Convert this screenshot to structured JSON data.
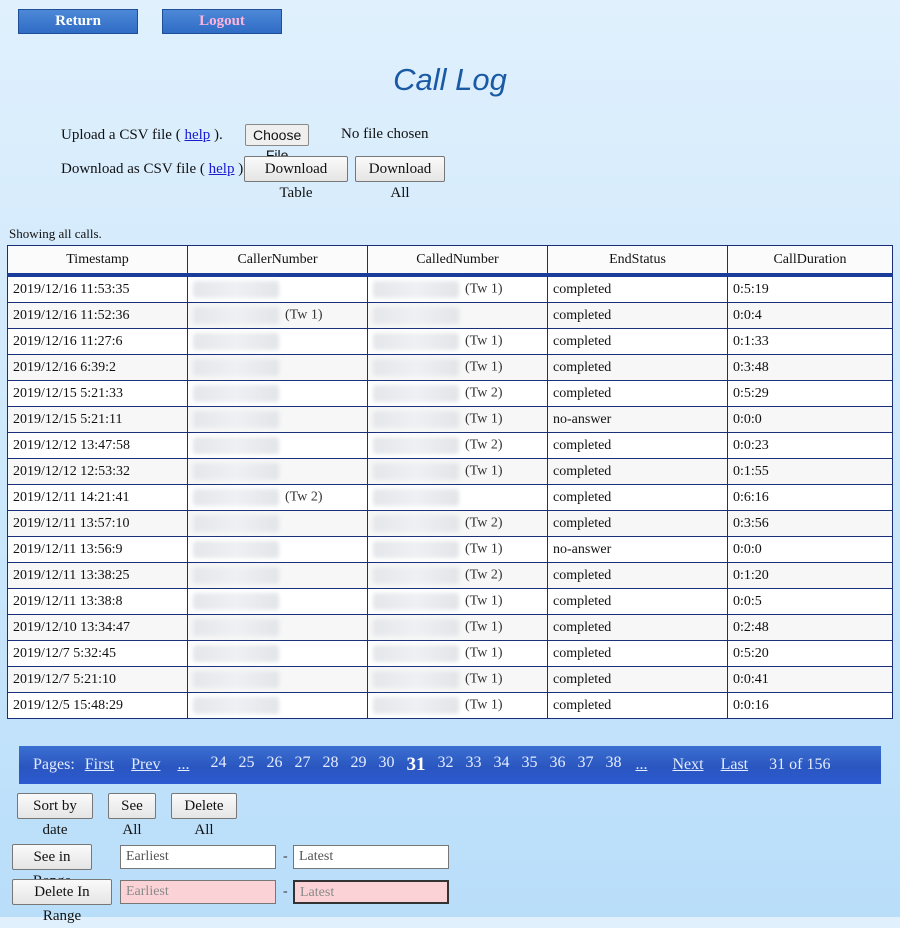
{
  "nav": {
    "return_label": "Return",
    "logout_label": "Logout"
  },
  "title": "Call Log",
  "upload": {
    "text": "Upload a CSV file (",
    "help": "help",
    "close": ").",
    "button": "Choose File",
    "status": "No file chosen"
  },
  "download": {
    "text": "Download as CSV file (",
    "help": "help",
    "close": ").",
    "table_button": "Download Table",
    "all_button": "Download All"
  },
  "showing": "Showing all calls.",
  "table": {
    "headers": [
      "Timestamp",
      "CallerNumber",
      "CalledNumber",
      "EndStatus",
      "CallDuration"
    ],
    "rows": [
      {
        "ts": "2019/12/16 11:53:35",
        "caller_tw": "",
        "called_tw": "(Tw 1)",
        "status": "completed",
        "dur": "0:5:19"
      },
      {
        "ts": "2019/12/16 11:52:36",
        "caller_tw": "(Tw 1)",
        "called_tw": "",
        "status": "completed",
        "dur": "0:0:4"
      },
      {
        "ts": "2019/12/16 11:27:6",
        "caller_tw": "",
        "called_tw": "(Tw 1)",
        "status": "completed",
        "dur": "0:1:33"
      },
      {
        "ts": "2019/12/16 6:39:2",
        "caller_tw": "",
        "called_tw": "(Tw 1)",
        "status": "completed",
        "dur": "0:3:48"
      },
      {
        "ts": "2019/12/15 5:21:33",
        "caller_tw": "",
        "called_tw": "(Tw 2)",
        "status": "completed",
        "dur": "0:5:29"
      },
      {
        "ts": "2019/12/15 5:21:11",
        "caller_tw": "",
        "called_tw": "(Tw 1)",
        "status": "no-answer",
        "dur": "0:0:0"
      },
      {
        "ts": "2019/12/12 13:47:58",
        "caller_tw": "",
        "called_tw": "(Tw 2)",
        "status": "completed",
        "dur": "0:0:23"
      },
      {
        "ts": "2019/12/12 12:53:32",
        "caller_tw": "",
        "called_tw": "(Tw 1)",
        "status": "completed",
        "dur": "0:1:55"
      },
      {
        "ts": "2019/12/11 14:21:41",
        "caller_tw": "(Tw 2)",
        "called_tw": "",
        "status": "completed",
        "dur": "0:6:16"
      },
      {
        "ts": "2019/12/11 13:57:10",
        "caller_tw": "",
        "called_tw": "(Tw 2)",
        "status": "completed",
        "dur": "0:3:56"
      },
      {
        "ts": "2019/12/11 13:56:9",
        "caller_tw": "",
        "called_tw": "(Tw 1)",
        "status": "no-answer",
        "dur": "0:0:0"
      },
      {
        "ts": "2019/12/11 13:38:25",
        "caller_tw": "",
        "called_tw": "(Tw 2)",
        "status": "completed",
        "dur": "0:1:20"
      },
      {
        "ts": "2019/12/11 13:38:8",
        "caller_tw": "",
        "called_tw": "(Tw 1)",
        "status": "completed",
        "dur": "0:0:5"
      },
      {
        "ts": "2019/12/10 13:34:47",
        "caller_tw": "",
        "called_tw": "(Tw 1)",
        "status": "completed",
        "dur": "0:2:48"
      },
      {
        "ts": "2019/12/7 5:32:45",
        "caller_tw": "",
        "called_tw": "(Tw 1)",
        "status": "completed",
        "dur": "0:5:20"
      },
      {
        "ts": "2019/12/7 5:21:10",
        "caller_tw": "",
        "called_tw": "(Tw 1)",
        "status": "completed",
        "dur": "0:0:41"
      },
      {
        "ts": "2019/12/5 15:48:29",
        "caller_tw": "",
        "called_tw": "(Tw 1)",
        "status": "completed",
        "dur": "0:0:16"
      }
    ]
  },
  "pager": {
    "label": "Pages:",
    "first": "First",
    "prev": "Prev",
    "ellipsis_left": "...",
    "pages": [
      "24",
      "25",
      "26",
      "27",
      "28",
      "29",
      "30",
      "31",
      "32",
      "33",
      "34",
      "35",
      "36",
      "37",
      "38"
    ],
    "current": "31",
    "ellipsis_right": "...",
    "next": "Next",
    "last": "Last",
    "count": "31 of 156"
  },
  "actions": {
    "sort": "Sort by date",
    "see_all": "See All",
    "delete_all": "Delete All"
  },
  "range": {
    "see_label": "See in Range",
    "delete_label": "Delete In Range",
    "earliest_placeholder": "Earliest",
    "latest_placeholder": "Latest",
    "separator": "-"
  },
  "colors": {
    "accent": "#1a5aa5",
    "pager_bg": "#2a56c0",
    "pink_input": "#fbd3d6"
  }
}
